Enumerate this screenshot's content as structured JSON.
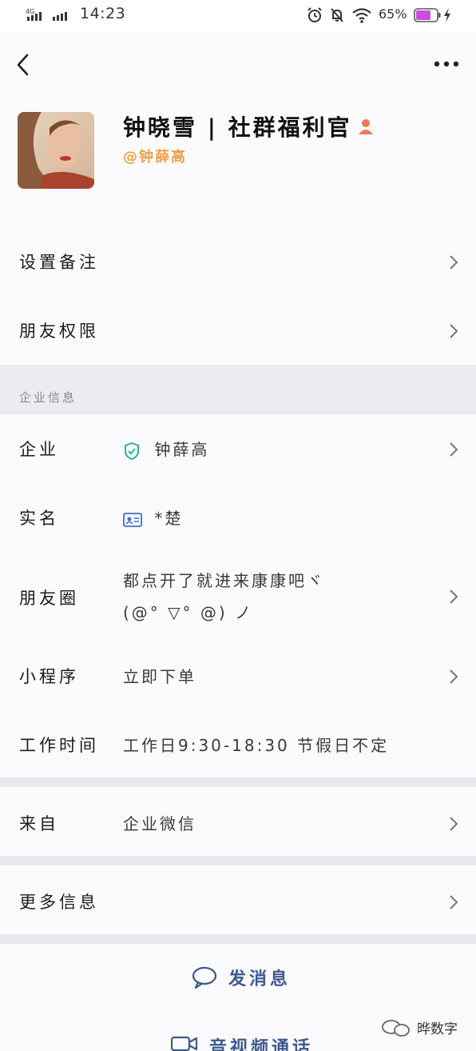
{
  "status_bar": {
    "network": "4G",
    "time": "14:23",
    "battery_percent": "65%"
  },
  "profile": {
    "name": "钟晓雪 | 社群福利官",
    "org": "@钟薛高"
  },
  "menu": {
    "set_remark": "设置备注",
    "friend_permission": "朋友权限"
  },
  "section": {
    "enterprise_info_title": "企业信息"
  },
  "enterprise": {
    "company_label": "企业",
    "company_value": "钟薛高",
    "realname_label": "实名",
    "realname_value": "*楚",
    "moments_label": "朋友圈",
    "moments_line1": "都点开了就进来康康吧ヾ",
    "moments_line2": "(@° ▽° @) ノ",
    "miniprogram_label": "小程序",
    "miniprogram_value": "立即下单",
    "hours_label": "工作时间",
    "hours_value": "工作日9:30-18:30 节假日不定"
  },
  "source": {
    "label": "来自",
    "value": "企业微信"
  },
  "more_info": {
    "label": "更多信息"
  },
  "actions": {
    "send_message": "发消息",
    "video_call": "音视频通话"
  },
  "watermark": {
    "label": "晔数字"
  },
  "colors": {
    "accent_blue": "#3d5a8e",
    "org_orange": "#f0a24a",
    "verified_teal": "#2bb39a"
  },
  "icons": {
    "back": "back-icon",
    "more": "more-icon",
    "chevron": "chevron-right-icon",
    "verified": "shield-check-icon",
    "id_card": "id-card-icon",
    "message": "chat-bubble-icon",
    "video": "video-camera-icon"
  }
}
